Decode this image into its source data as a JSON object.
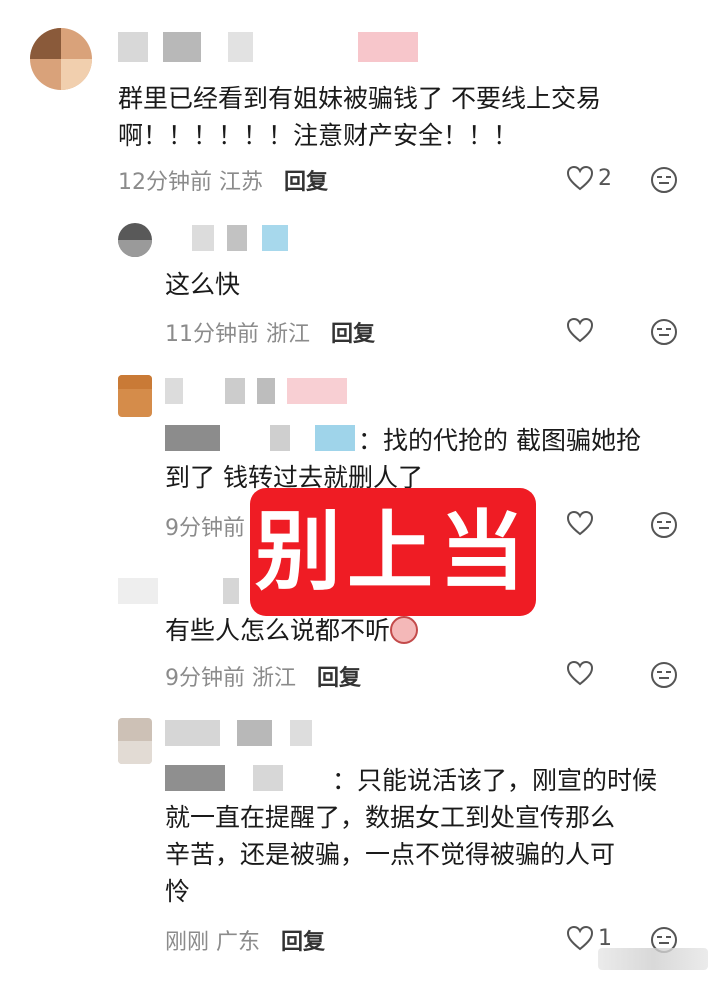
{
  "comments": [
    {
      "text_lines": [
        "群里已经看到有姐妹被骗钱了 不要线上交易",
        "啊！！！！！！注意财产安全！！！"
      ],
      "time": "12分钟前",
      "location": "江苏",
      "reply_label": "回复",
      "likes": "2"
    },
    {
      "text_lines": [
        "这么快"
      ],
      "time": "11分钟前",
      "location": "浙江",
      "reply_label": "回复",
      "likes": ""
    },
    {
      "text_lines": [
        "：找的代抢的 截图骗她抢",
        "到了 钱转过去就删人了"
      ],
      "time": "9分钟前",
      "location": "",
      "reply_label": "",
      "likes": ""
    },
    {
      "text_lines": [
        "有些人怎么说都不听"
      ],
      "time": "9分钟前",
      "location": "浙江",
      "reply_label": "回复",
      "likes": ""
    },
    {
      "text_lines": [
        "：只能说活该了，刚宣的时候",
        "就一直在提醒了，数据女工到处宣传那么",
        "辛苦，还是被骗，一点不觉得被骗的人可",
        "怜"
      ],
      "time": "刚刚",
      "location": "广东",
      "reply_label": "回复",
      "likes": "1"
    }
  ],
  "overlay": {
    "stamp_text": "别上当"
  },
  "colors": {
    "stamp": "#ef1c24",
    "meta": "#8b8b8b"
  },
  "icons": {
    "like": "heart-outline-icon",
    "dislike": "neutral-face-icon"
  }
}
